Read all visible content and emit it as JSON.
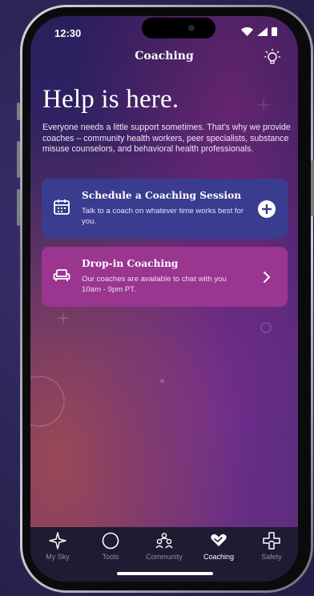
{
  "status_bar": {
    "time": "12:30"
  },
  "header": {
    "title": "Coaching",
    "right_icon": "lightbulb-icon"
  },
  "hero": {
    "headline": "Help is here.",
    "intro": "Everyone needs a little support sometimes. That's why we provide coaches – community health workers, peer specialists, substance misuse counselors, and behavioral health professionals."
  },
  "cards": {
    "schedule": {
      "title": "Schedule a Coaching Session",
      "description": "Talk to a coach on whatever time works best for you.",
      "icon": "calendar-icon",
      "action_icon": "plus-circle-icon",
      "color": "#3a3c90"
    },
    "dropin": {
      "title": "Drop-in Coaching",
      "description": "Our coaches are available to chat with you 10am - 9pm PT.",
      "icon": "couch-icon",
      "action_icon": "chevron-right-icon",
      "color": "#9a3590"
    }
  },
  "tabs": [
    {
      "label": "My Sky",
      "icon": "diamond-icon",
      "active": false
    },
    {
      "label": "Tools",
      "icon": "circle-icon",
      "active": false
    },
    {
      "label": "Community",
      "icon": "people-icon",
      "active": false
    },
    {
      "label": "Coaching",
      "icon": "heart-hands-icon",
      "active": true
    },
    {
      "label": "Safety",
      "icon": "safety-cross-icon",
      "active": false
    }
  ],
  "colors": {
    "tab_active": "#ffffff",
    "tab_inactive": "#8f8da3",
    "tabbar_bg": "#1e1c32"
  }
}
